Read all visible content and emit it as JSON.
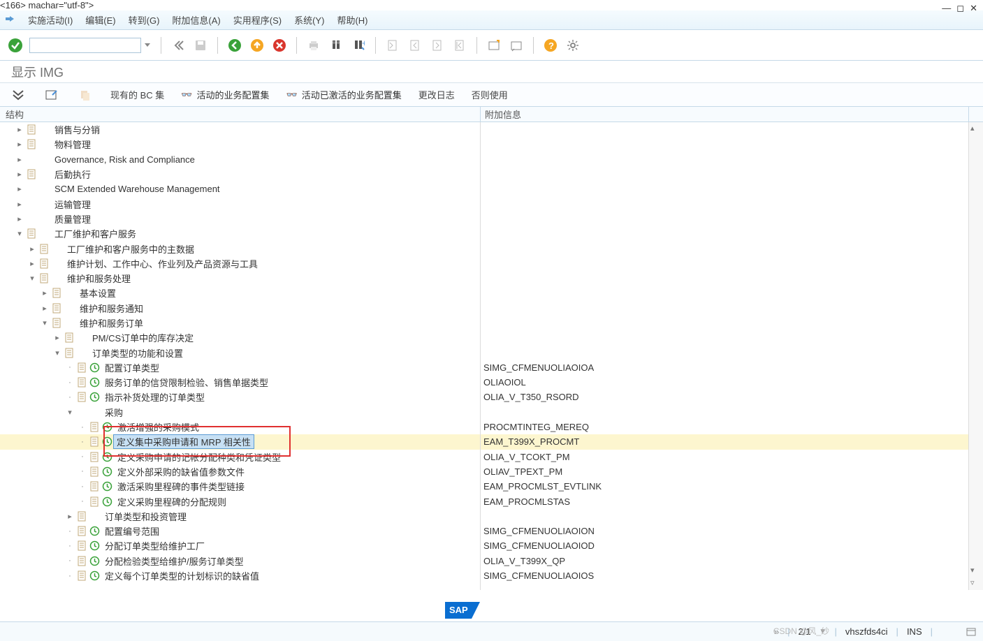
{
  "menu": {
    "items": [
      "实施活动(I)",
      "编辑(E)",
      "转到(G)",
      "附加信息(A)",
      "实用程序(S)",
      "系统(Y)",
      "帮助(H)"
    ]
  },
  "title": "显示 IMG",
  "subtoolbar": {
    "bc_set": "现有的 BC 集",
    "active_bc": "活动的业务配置集",
    "activated_bc": "活动已激活的业务配置集",
    "change_log": "更改日志",
    "else_use": "否则使用"
  },
  "columns": {
    "struct": "结构",
    "info": "附加信息"
  },
  "tree": [
    {
      "level": 0,
      "exp": ">",
      "doc": true,
      "clock": false,
      "label": "销售与分销",
      "info": ""
    },
    {
      "level": 0,
      "exp": ">",
      "doc": true,
      "clock": false,
      "label": "物料管理",
      "info": ""
    },
    {
      "level": 0,
      "exp": ">",
      "doc": false,
      "clock": false,
      "label": "Governance, Risk and Compliance",
      "info": ""
    },
    {
      "level": 0,
      "exp": ">",
      "doc": true,
      "clock": false,
      "label": "后勤执行",
      "info": ""
    },
    {
      "level": 0,
      "exp": ">",
      "doc": false,
      "clock": false,
      "label": "SCM Extended Warehouse Management",
      "info": ""
    },
    {
      "level": 0,
      "exp": ">",
      "doc": false,
      "clock": false,
      "label": "运输管理",
      "info": ""
    },
    {
      "level": 0,
      "exp": ">",
      "doc": false,
      "clock": false,
      "label": "质量管理",
      "info": ""
    },
    {
      "level": 0,
      "exp": "v",
      "doc": true,
      "clock": false,
      "label": "工厂维护和客户服务",
      "info": ""
    },
    {
      "level": 1,
      "exp": ">",
      "doc": true,
      "clock": false,
      "label": "工厂维护和客户服务中的主数据",
      "info": ""
    },
    {
      "level": 1,
      "exp": ">",
      "doc": true,
      "clock": false,
      "label": "维护计划、工作中心、作业列及产品资源与工具",
      "info": ""
    },
    {
      "level": 1,
      "exp": "v",
      "doc": true,
      "clock": false,
      "label": "维护和服务处理",
      "info": ""
    },
    {
      "level": 2,
      "exp": ">",
      "doc": true,
      "clock": false,
      "label": "基本设置",
      "info": ""
    },
    {
      "level": 2,
      "exp": ">",
      "doc": true,
      "clock": false,
      "label": "维护和服务通知",
      "info": ""
    },
    {
      "level": 2,
      "exp": "v",
      "doc": true,
      "clock": false,
      "label": "维护和服务订单",
      "info": ""
    },
    {
      "level": 3,
      "exp": ">",
      "doc": true,
      "clock": false,
      "label": "PM/CS订单中的库存决定",
      "info": ""
    },
    {
      "level": 3,
      "exp": "v",
      "doc": true,
      "clock": false,
      "label": "订单类型的功能和设置",
      "info": ""
    },
    {
      "level": 4,
      "exp": "·",
      "doc": true,
      "clock": true,
      "label": "配置订单类型",
      "info": "SIMG_CFMENUOLIAOIOA"
    },
    {
      "level": 4,
      "exp": "·",
      "doc": true,
      "clock": true,
      "label": "服务订单的信贷限制检验、销售单据类型",
      "info": "OLIAOIOL"
    },
    {
      "level": 4,
      "exp": "·",
      "doc": true,
      "clock": true,
      "label": "指示补货处理的订单类型",
      "info": "OLIA_V_T350_RSORD"
    },
    {
      "level": 4,
      "exp": "v",
      "doc": false,
      "clock": false,
      "label": "采购",
      "info": ""
    },
    {
      "level": 5,
      "exp": "·",
      "doc": true,
      "clock": true,
      "label": "激活增强的采购模式",
      "info": "PROCMTINTEG_MEREQ"
    },
    {
      "level": 5,
      "exp": "·",
      "doc": true,
      "clock": true,
      "label": "定义集中采购申请和 MRP 相关性",
      "info": "EAM_T399X_PROCMT",
      "hl": true
    },
    {
      "level": 5,
      "exp": "·",
      "doc": true,
      "clock": true,
      "label": "定义采购申请的记帐分配种类和凭证类型",
      "info": "OLIA_V_TCOKT_PM"
    },
    {
      "level": 5,
      "exp": "·",
      "doc": true,
      "clock": true,
      "label": "定义外部采购的缺省值参数文件",
      "info": "OLIAV_TPEXT_PM"
    },
    {
      "level": 5,
      "exp": "·",
      "doc": true,
      "clock": true,
      "label": "激活采购里程碑的事件类型链接",
      "info": "EAM_PROCMLST_EVTLINK"
    },
    {
      "level": 5,
      "exp": "·",
      "doc": true,
      "clock": true,
      "label": "定义采购里程碑的分配规则",
      "info": "EAM_PROCMLSTAS"
    },
    {
      "level": 4,
      "exp": ">",
      "doc": true,
      "clock": false,
      "label": "订单类型和投资管理",
      "info": ""
    },
    {
      "level": 4,
      "exp": "·",
      "doc": true,
      "clock": true,
      "label": "配置编号范围",
      "info": "SIMG_CFMENUOLIAOION"
    },
    {
      "level": 4,
      "exp": "·",
      "doc": true,
      "clock": true,
      "label": "分配订单类型给维护工厂",
      "info": "SIMG_CFMENUOLIAOIOD"
    },
    {
      "level": 4,
      "exp": "·",
      "doc": true,
      "clock": true,
      "label": "分配检验类型给维护/服务订单类型",
      "info": "OLIA_V_T399X_QP"
    },
    {
      "level": 4,
      "exp": "·",
      "doc": true,
      "clock": true,
      "label": "定义每个订单类型的计划标识的缺省值",
      "info": "SIMG_CFMENUOLIAOIOS"
    }
  ],
  "status": {
    "page": "2/1",
    "server": "vhszfds4ci",
    "mode": "INS"
  },
  "watermark": "CSDN @风_纱"
}
